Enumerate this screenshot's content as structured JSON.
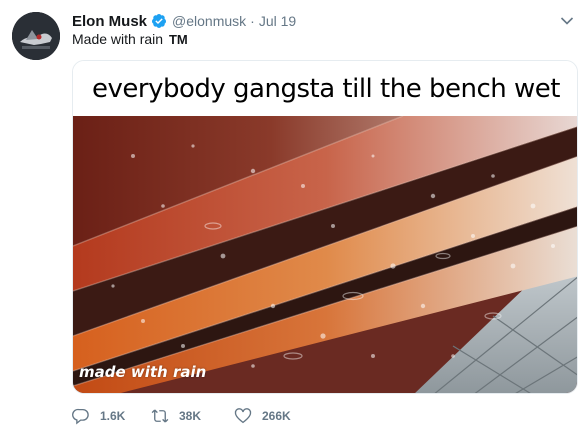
{
  "tweet": {
    "display_name": "Elon Musk",
    "handle": "@elonmusk",
    "separator": "·",
    "date": "Jul 19",
    "text": "Made with rain",
    "text_suffix": "TM",
    "verified": true
  },
  "media": {
    "caption": "everybody gangsta till the bench wet",
    "watermark": "made with rain"
  },
  "actions": {
    "replies": "1.6K",
    "retweets": "38K",
    "likes": "266K"
  },
  "icons": {
    "verified": "verified-badge-icon",
    "more": "chevron-down-icon",
    "reply": "reply-icon",
    "retweet": "retweet-icon",
    "like": "heart-icon"
  },
  "colors": {
    "verified_blue": "#1da1f2",
    "secondary_text": "#657786",
    "primary_text": "#14171a"
  }
}
